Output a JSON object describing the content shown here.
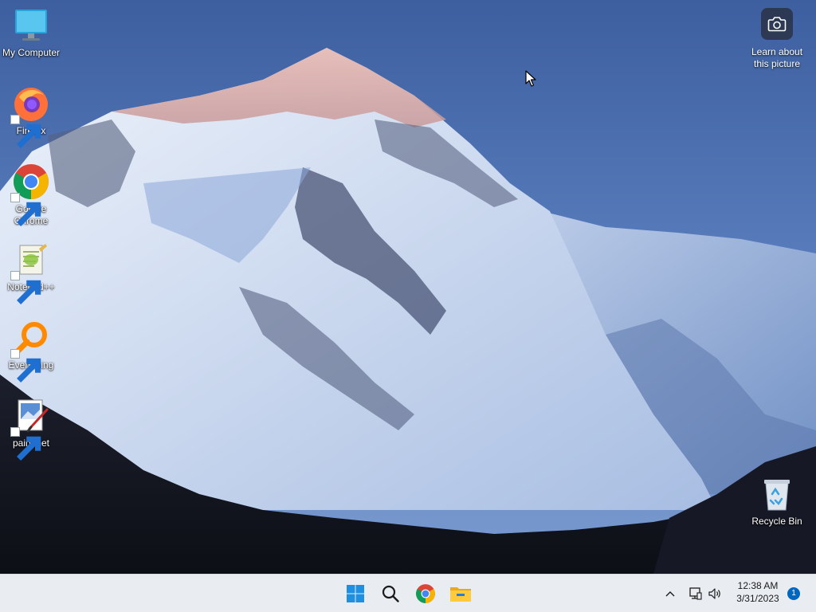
{
  "desktop": {
    "icons": [
      {
        "id": "my-computer",
        "label": "My Computer",
        "icon": "monitor-icon"
      },
      {
        "id": "firefox",
        "label": "Firefox",
        "icon": "firefox-icon"
      },
      {
        "id": "google-chrome",
        "label": "Google Chrome",
        "icon": "chrome-icon"
      },
      {
        "id": "notepad-plus-plus",
        "label": "Notepad++",
        "icon": "notepad-plus-plus-icon"
      },
      {
        "id": "everything",
        "label": "Everything",
        "icon": "everything-search-icon"
      },
      {
        "id": "paint-net",
        "label": "paint.net",
        "icon": "paint-net-icon"
      },
      {
        "id": "recycle-bin",
        "label": "Recycle Bin",
        "icon": "recycle-bin-icon"
      }
    ],
    "spotlight": {
      "label": "Learn about this picture",
      "icon": "camera-icon"
    }
  },
  "taskbar": {
    "pinned": [
      {
        "id": "start",
        "icon": "windows-start-icon"
      },
      {
        "id": "search",
        "icon": "search-icon"
      },
      {
        "id": "chrome",
        "icon": "chrome-icon"
      },
      {
        "id": "file-explorer",
        "icon": "folder-icon"
      }
    ],
    "tray": {
      "time": "12:38 AM",
      "date": "3/31/2023",
      "notification_count": "1"
    }
  },
  "colors": {
    "taskbar_bg": "#e9edf2",
    "accent": "#0067c0",
    "sky": "#4a6fae"
  }
}
